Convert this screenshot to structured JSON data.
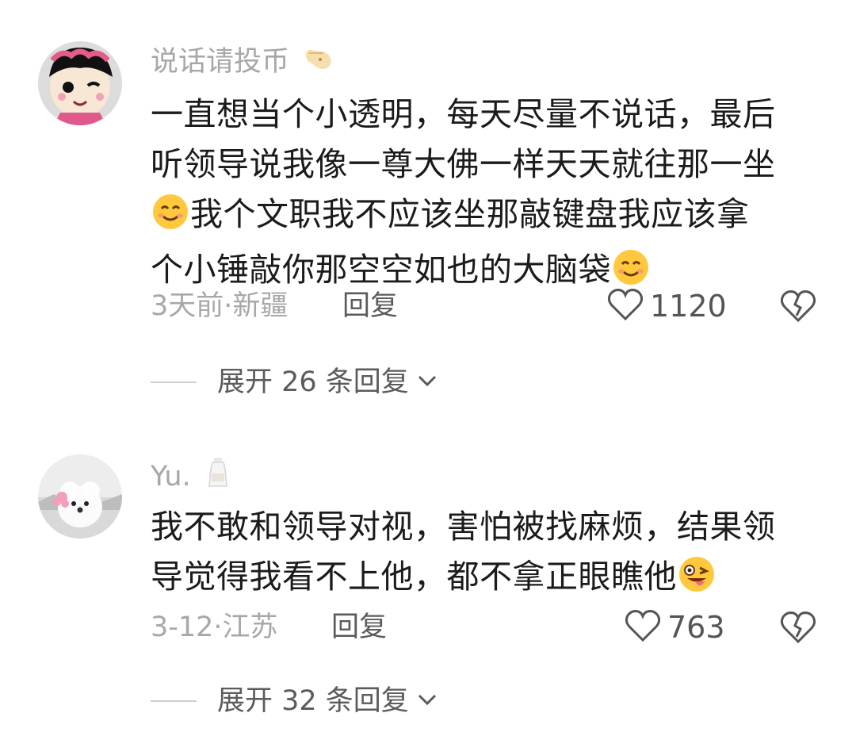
{
  "comments": [
    {
      "username": "说话请投币",
      "badge_icon": "finger-badge-icon",
      "lines": [
        "一直想当个小透明，每天尽量不说话，最后",
        "听领导说我像一尊大佛一样天天就往那一坐",
        "我个文职我不应该坐那敲键盘我应该拿",
        "个小锤敲你那空空如也的大脑袋"
      ],
      "emoji": "smile-emoji",
      "meta": "3天前·新疆",
      "reply_label": "回复",
      "likes": "1120",
      "expand_label": "展开 26 条回复"
    },
    {
      "username": "Yu.",
      "badge_icon": "milk-bottle-badge-icon",
      "lines": [
        "我不敢和领导对视，害怕被找麻烦，结果领",
        "导觉得我看不上他，都不拿正眼瞧他"
      ],
      "emoji": "wink-tongue-emoji",
      "meta": "3-12·江苏",
      "reply_label": "回复",
      "likes": "763",
      "expand_label": "展开 32 条回复"
    }
  ],
  "colors": {
    "text": "#1b1b1b",
    "muted": "#a8a8a8",
    "secondary": "#5b5b5b",
    "emoji": "#ffc83d"
  }
}
